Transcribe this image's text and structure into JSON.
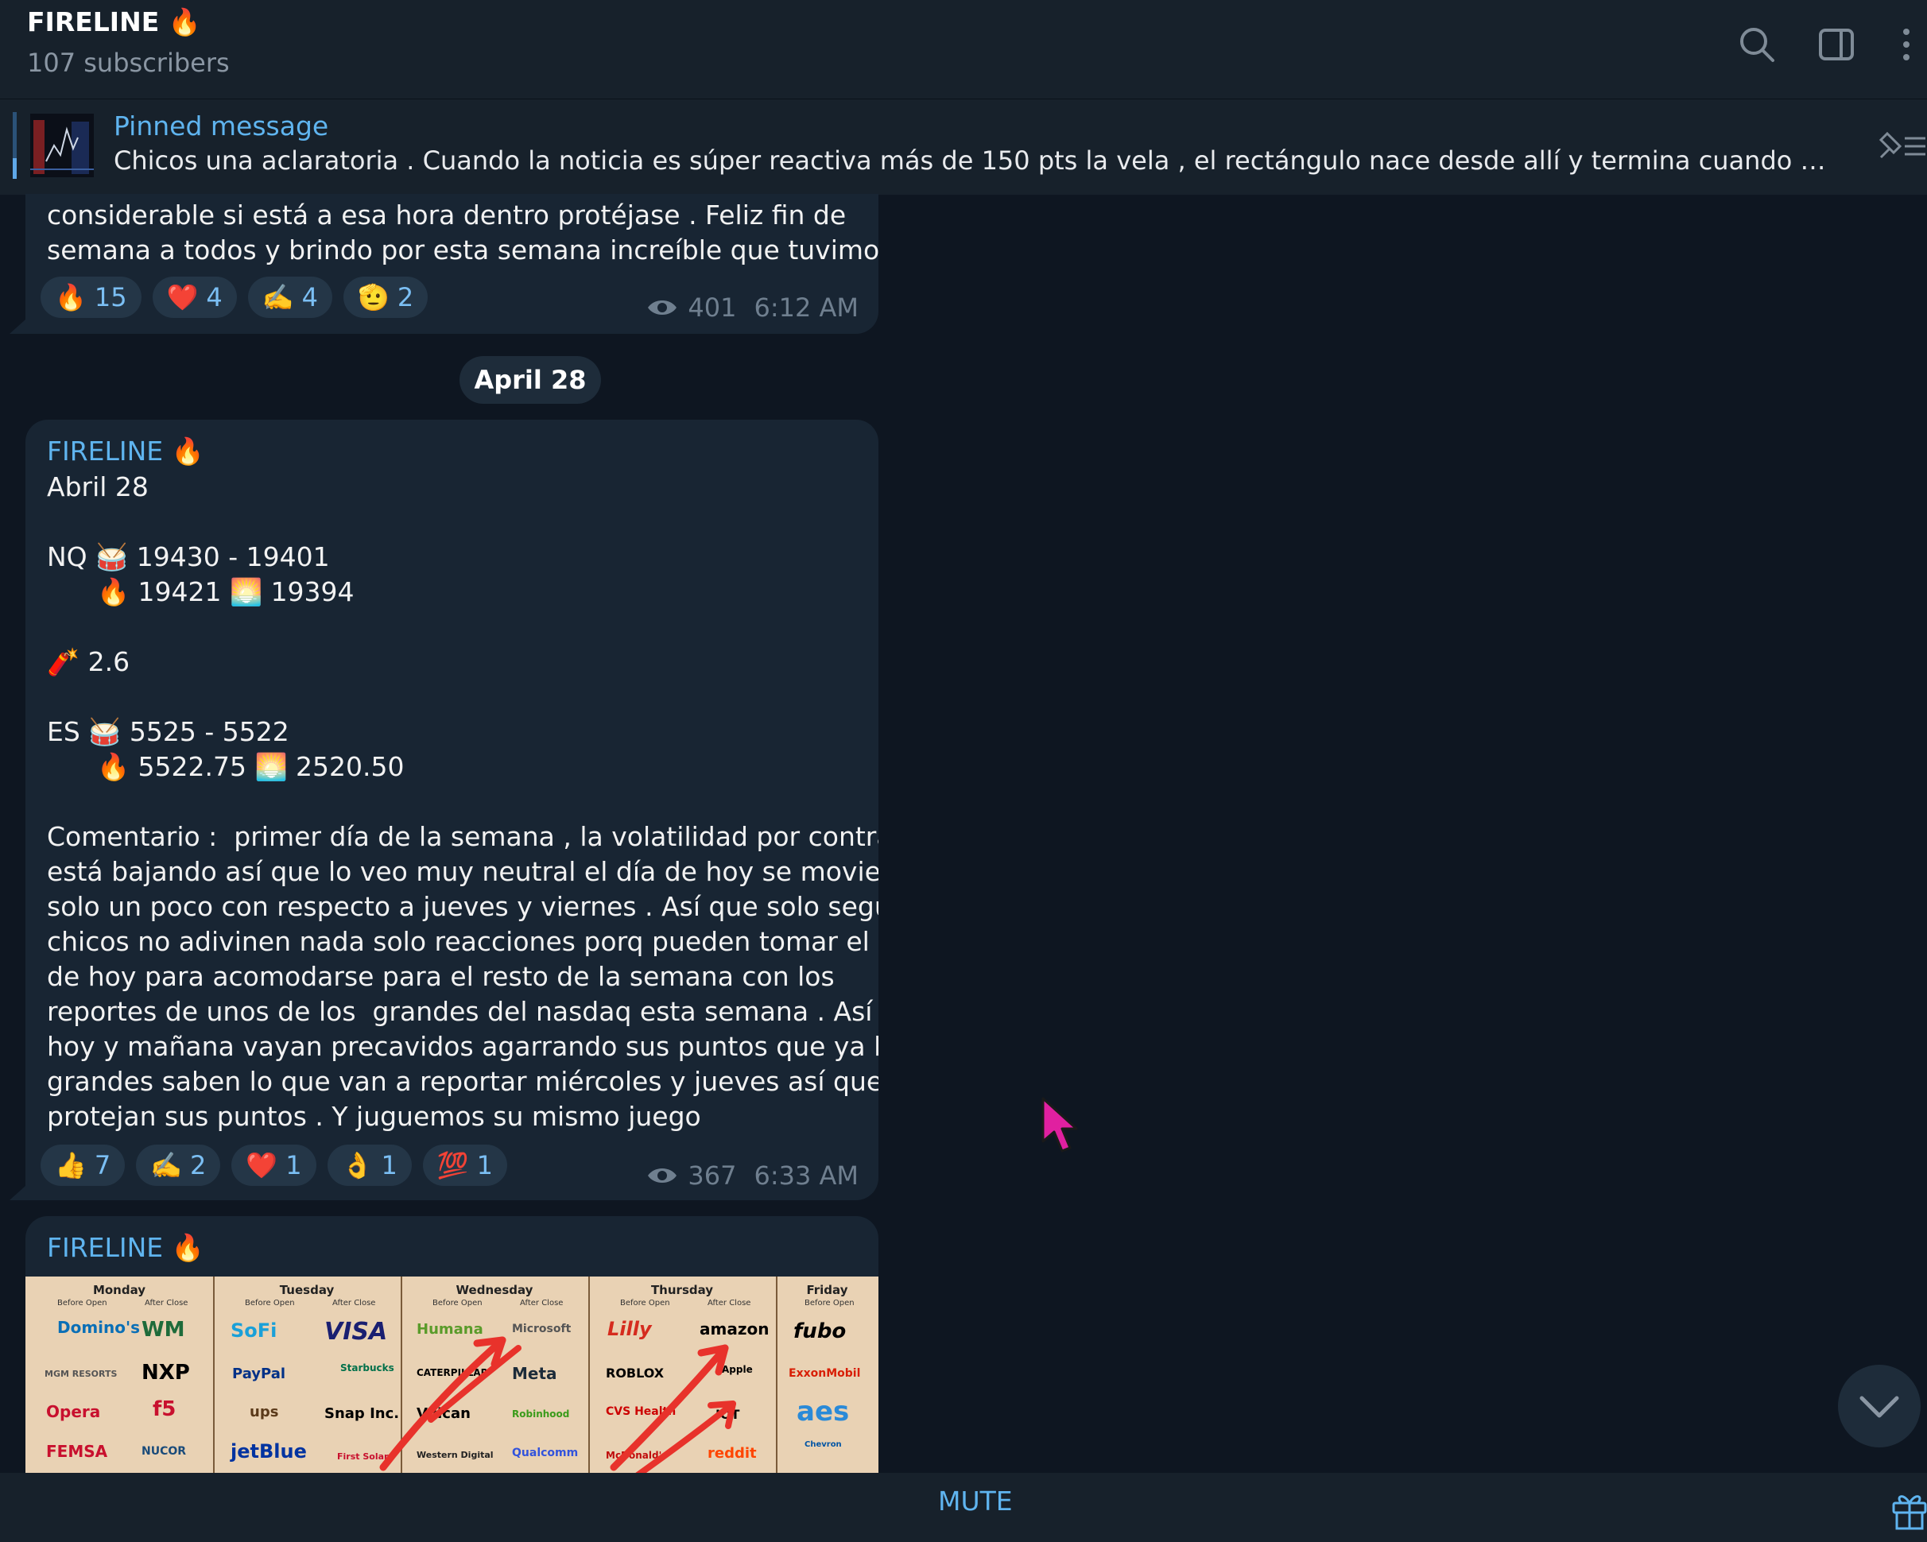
{
  "header": {
    "title": "FIRELINE 🔥",
    "subtitle": "107 subscribers"
  },
  "pinned": {
    "label": "Pinned message",
    "text": "Chicos una aclaratoria .  Cuando la noticia es súper reactiva más de 150 pts la vela , el rectángulo nace desde allí y termina cuando complete las..."
  },
  "message1": {
    "lines": "considerable si está a esa hora dentro protéjase . Feliz fin de\nsemana a todos y brindo por esta semana increíble que tuvimos 🥃",
    "reactions": [
      {
        "emoji": "🔥",
        "count": "15"
      },
      {
        "emoji": "❤️",
        "count": "4"
      },
      {
        "emoji": "✍️",
        "count": "4"
      },
      {
        "emoji": "🫡",
        "count": "2"
      }
    ],
    "views": "401",
    "time": "6:12 AM"
  },
  "date_separator": "April 28",
  "message2": {
    "sender": "FIRELINE 🔥",
    "text": "Abril 28\n\nNQ 🥁 19430 - 19401\n      🔥 19421 🌅 19394\n\n🧨 2.6\n\nES 🥁 5525 - 5522\n      🔥 5522.75 🌅 2520.50\n\nComentario :  primer día de la semana , la volatilidad por contratos\nestá bajando así que lo veo muy neutral el día de hoy se movieron\nsolo un poco con respecto a jueves y viernes . Así que solo seguirlos\nchicos no adivinen nada solo reacciones porq pueden tomar el día\nde hoy para acomodarse para el resto de la semana con los\nreportes de unos de los  grandes del nasdaq esta semana . Así que\nhoy y mañana vayan precavidos agarrando sus puntos que ya los\ngrandes saben lo que van a reportar miércoles y jueves así que\nprotejan sus puntos . Y juguemos su mismo juego",
    "reactions": [
      {
        "emoji": "👍",
        "count": "7"
      },
      {
        "emoji": "✍️",
        "count": "2"
      },
      {
        "emoji": "❤️",
        "count": "1"
      },
      {
        "emoji": "👌",
        "count": "1"
      },
      {
        "emoji": "💯",
        "count": "1"
      }
    ],
    "views": "367",
    "time": "6:33 AM"
  },
  "message3": {
    "sender": "FIRELINE 🔥",
    "earnings_image": {
      "days": [
        {
          "name": "Monday",
          "before": "Before Open",
          "after": "After Close",
          "logos": [
            "Domino's",
            "WM",
            "MGM RESORTS",
            "NXP",
            "Opera",
            "f5",
            "FEMSA",
            "NUCOR"
          ]
        },
        {
          "name": "Tuesday",
          "before": "Before Open",
          "after": "After Close",
          "logos": [
            "SoFi",
            "VISA",
            "PayPal",
            "Starbucks",
            "ups",
            "Snap Inc.",
            "jetBlue",
            "First Solar"
          ]
        },
        {
          "name": "Wednesday",
          "before": "Before Open",
          "after": "After Close",
          "logos": [
            "Humana",
            "Microsoft",
            "CATERPILLAR",
            "Meta",
            "Vulcan",
            "Robinhood",
            "Western Digital",
            "Qualcomm"
          ]
        },
        {
          "name": "Thursday",
          "before": "Before Open",
          "after": "After Close",
          "logos": [
            "Lilly",
            "amazon",
            "ROBLOX",
            "Apple",
            "CVS Health",
            "IOT",
            "McDonald's",
            "reddit"
          ]
        },
        {
          "name": "Friday",
          "before": "Before Open",
          "logos": [
            "fubo",
            "ExxonMobil",
            "aes",
            "Chevron"
          ]
        }
      ]
    }
  },
  "bottom_bar": {
    "mute_label": "MUTE"
  },
  "icons": {
    "search": "search-icon",
    "sidebar": "sidebar-toggle-icon",
    "more": "more-vertical-icon",
    "views": "eye-icon",
    "pinned_list": "pin-list-icon",
    "scroll": "chevron-down-icon",
    "gift": "gift-icon"
  },
  "colors": {
    "background": "#0e1621",
    "panel": "#17212b",
    "bubble": "#182533",
    "accent": "#5fb4ef"
  }
}
